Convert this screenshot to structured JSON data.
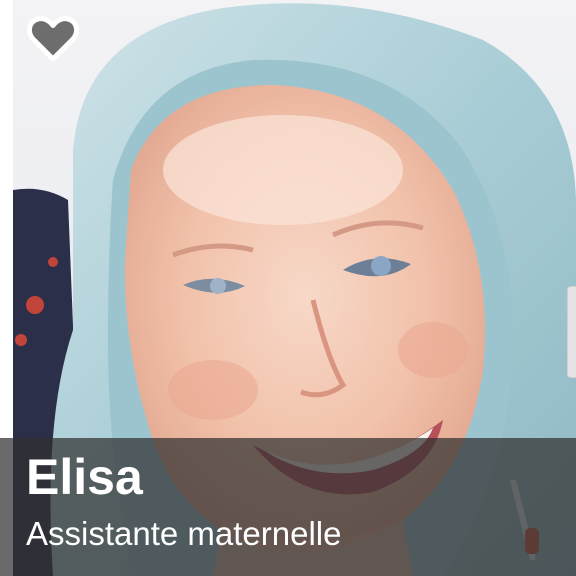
{
  "profile": {
    "name": "Elisa",
    "role": "Assistante maternelle"
  },
  "photo": {
    "alt": "Elisa"
  },
  "icons": {
    "favorite": "heart-outline-icon"
  },
  "colors": {
    "overlay": "#303030",
    "text": "#ffffff",
    "hood": "#a9cdd6"
  }
}
